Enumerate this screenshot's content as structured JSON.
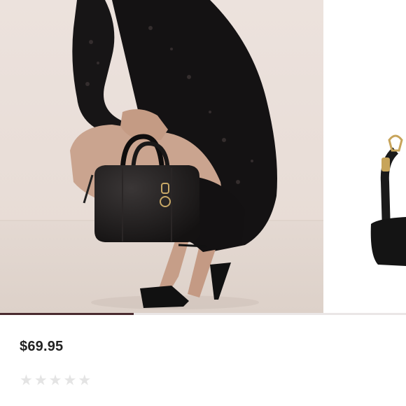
{
  "product": {
    "price": "$69.95",
    "rating": {
      "filled": 0,
      "max": 5
    }
  },
  "gallery": {
    "main_image": "model-with-black-barrel-handbag",
    "next_image": "black-handbag-with-strap",
    "progress": 0.33
  },
  "colors": {
    "accent": "#4a2a2e",
    "track": "#eae6e6",
    "star_empty": "#e4e4e4"
  }
}
